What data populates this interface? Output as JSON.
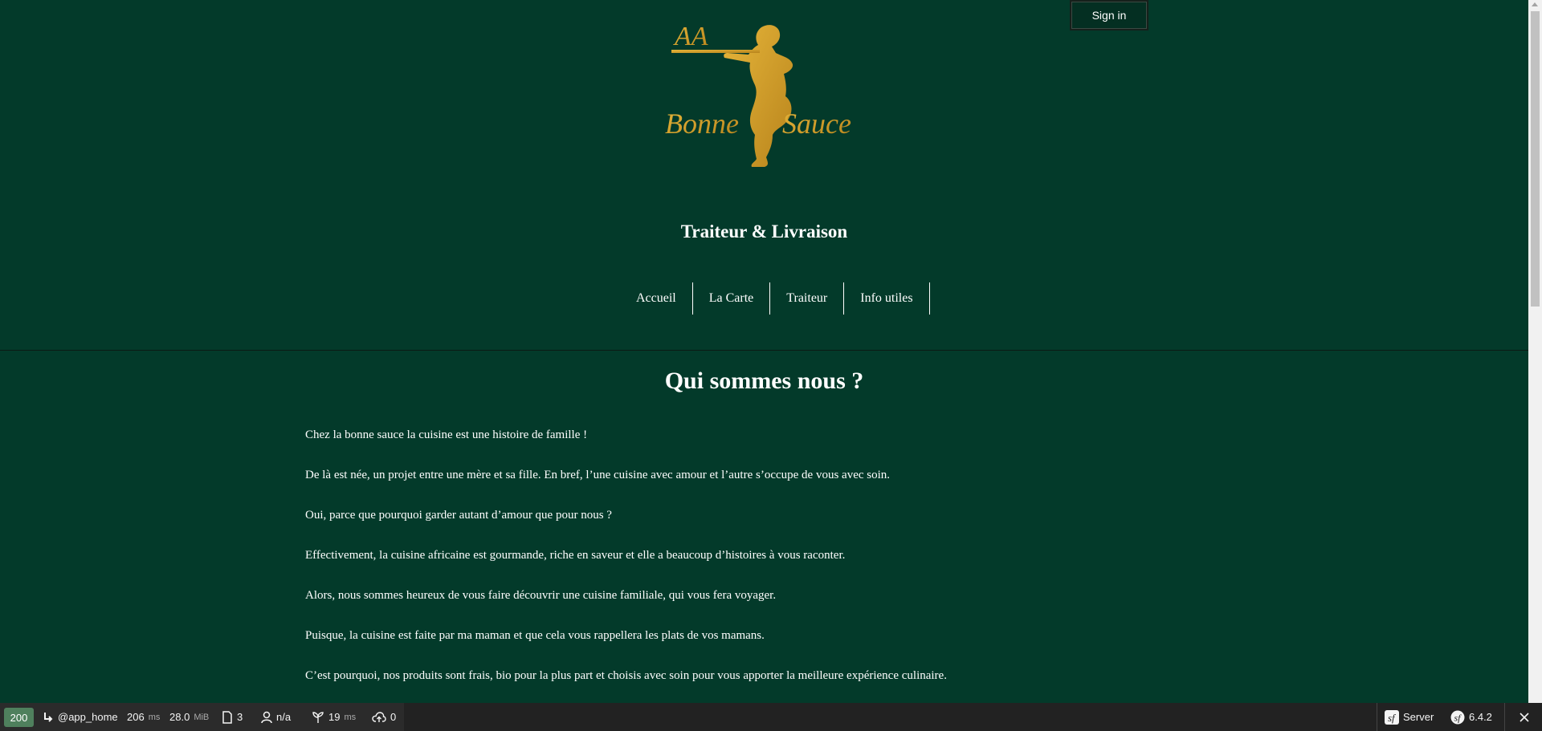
{
  "header": {
    "sign_in": "Sign in",
    "logo_alt": "AA Bonne Sauce",
    "logo_text_aa": "AA",
    "logo_text_bonne": "Bonne",
    "logo_text_sauce": "Sauce",
    "tagline": "Traiteur & Livraison"
  },
  "nav": {
    "items": [
      {
        "label": "Accueil"
      },
      {
        "label": "La Carte"
      },
      {
        "label": "Traiteur"
      },
      {
        "label": "Info utiles"
      }
    ]
  },
  "main": {
    "title": "Qui sommes nous ?",
    "paragraphs": [
      "Chez la bonne sauce la cuisine est une histoire de famille !",
      "De là est née, un projet entre une mère et sa fille. En bref, l’une cuisine avec amour et l’autre s’occupe de vous avec soin.",
      "Oui, parce que pourquoi garder autant d’amour que pour nous ?",
      "Effectivement, la cuisine africaine est gourmande, riche en saveur et elle a beaucoup d’histoires à vous raconter.",
      "Alors, nous sommes heureux de vous faire découvrir une cuisine familiale, qui vous fera voyager.",
      "Puisque, la cuisine est faite par ma maman et que cela vous rappellera les plats de vos mamans.",
      "C’est pourquoi, nos produits sont frais, bio pour la plus part et choisis avec soin pour vous apporter la meilleure expérience culinaire."
    ]
  },
  "toolbar": {
    "status_code": "200",
    "route": "@app_home",
    "time_value": "206",
    "time_unit": "ms",
    "memory_value": "28.0",
    "memory_unit": "MiB",
    "templates_count": "3",
    "user": "n/a",
    "twig_value": "19",
    "twig_unit": "ms",
    "ajax_count": "0",
    "server_label": "Server",
    "symfony_version": "6.4.2"
  },
  "colors": {
    "background": "#033a2a",
    "logo_gold": "#d4a02a",
    "status_green": "#4f805d"
  }
}
